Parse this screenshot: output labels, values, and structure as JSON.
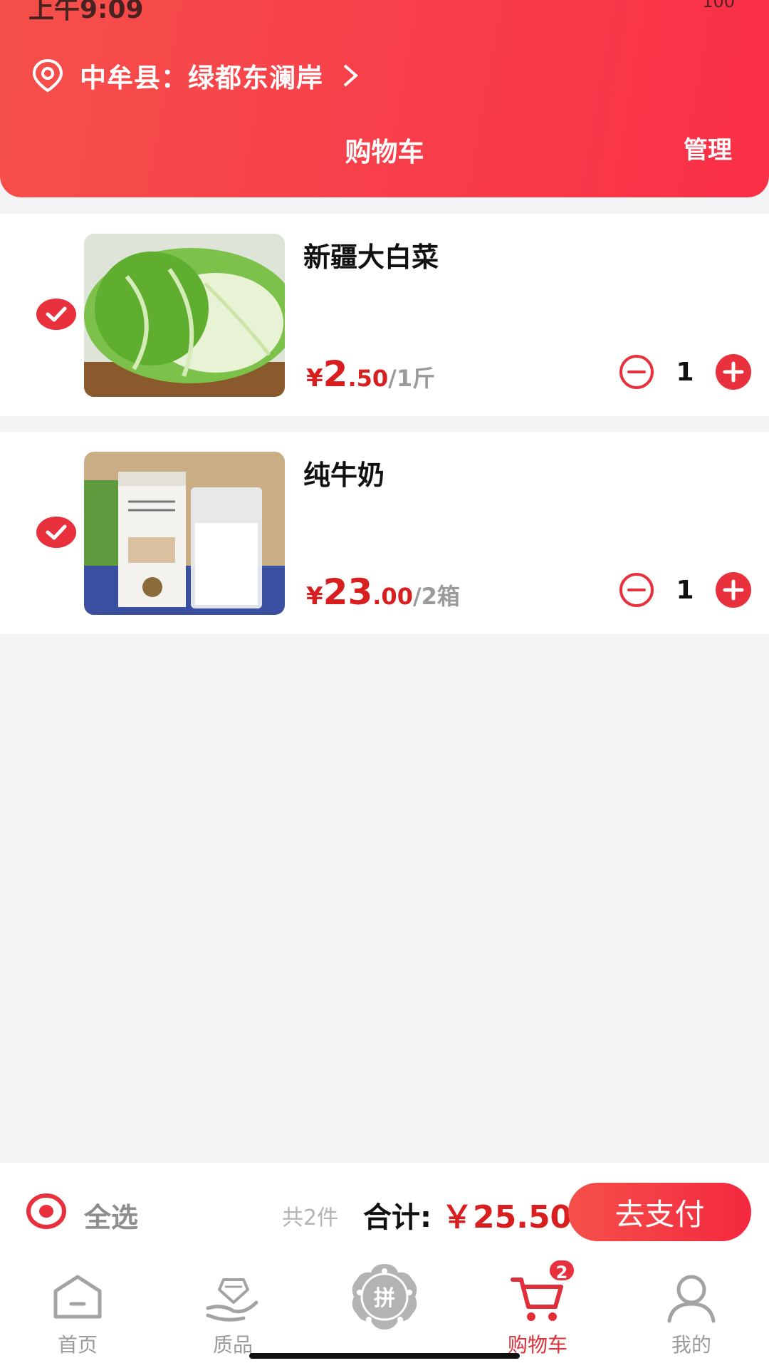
{
  "status_bar": {
    "time": "上午9:09",
    "battery": "100"
  },
  "header": {
    "location": "中牟县：绿都东澜岸",
    "title": "购物车",
    "manage_label": "管理"
  },
  "cart_items": [
    {
      "name": "新疆大白菜",
      "currency": "¥",
      "price_int": "2",
      "price_dec": ".50",
      "unit": "/1斤",
      "quantity": "1",
      "checked": true
    },
    {
      "name": "纯牛奶",
      "currency": "¥",
      "price_int": "23",
      "price_dec": ".00",
      "unit": "/2箱",
      "quantity": "1",
      "checked": true
    }
  ],
  "checkout": {
    "select_all_label": "全选",
    "count_text": "共2件",
    "total_label": "合计:",
    "total_value": "￥25.50",
    "pay_label": "去支付"
  },
  "tabbar": {
    "tabs": [
      {
        "label": "首页",
        "icon": "home-icon"
      },
      {
        "label": "质品",
        "icon": "quality-hand-icon"
      },
      {
        "label": "拼",
        "icon": "group-buy-icon"
      },
      {
        "label": "购物车",
        "icon": "cart-icon",
        "badge": "2",
        "active": true
      },
      {
        "label": "我的",
        "icon": "user-icon"
      }
    ]
  },
  "colors": {
    "brand_red": "#f5504a",
    "price_red": "#d81e1e",
    "inactive_gray": "#9b9b9b"
  }
}
